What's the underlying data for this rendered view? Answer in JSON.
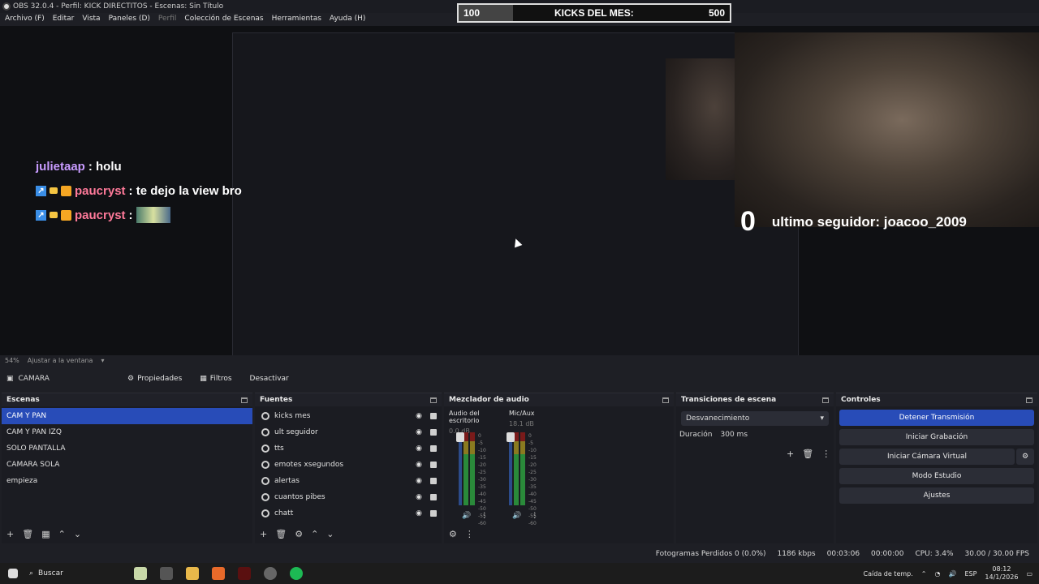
{
  "window": {
    "title": "OBS 32.0.4 - Perfil: KICK DIRECTITOS - Escenas: Sin Título"
  },
  "menu": [
    "Archivo (F)",
    "Editar",
    "Vista",
    "Paneles (D)",
    "Perfil",
    "Colección de Escenas",
    "Herramientas",
    "Ayuda (H)"
  ],
  "overlay": {
    "kicks_left": "100",
    "kicks_label": "KICKS DEL MES:",
    "kicks_right": "500",
    "kicks_progress": 0.2,
    "chat": [
      {
        "user": "julietaap",
        "message": ": holu"
      },
      {
        "user": "paucryst",
        "message": ": te dejo la view bro"
      },
      {
        "user": "paucryst",
        "message": ":"
      }
    ],
    "follower_count": "0",
    "follower_label": "ultimo seguidor: joacoo_2009"
  },
  "zoom": {
    "level": "54%",
    "fit": "Ajustar a la ventana"
  },
  "context": {
    "source": "CAMARA",
    "properties": "Propiedades",
    "filters": "Filtros",
    "deactivate": "Desactivar"
  },
  "scenes": {
    "title": "Escenas",
    "items": [
      "CAM Y PAN",
      "CAM Y PAN IZQ",
      "SOLO PANTALLA",
      "CAMARA SOLA",
      "empieza"
    ],
    "selected": 0
  },
  "sources": {
    "title": "Fuentes",
    "items": [
      "kicks mes",
      "ult seguidor",
      "tts",
      "emotes xsegundos",
      "alertas",
      "cuantos pibes",
      "chatt"
    ]
  },
  "mixer": {
    "title": "Mezclador de audio",
    "channels": [
      {
        "name": "Audio del escritorio",
        "db": "0.0 dB"
      },
      {
        "name": "Mic/Aux",
        "db": "18.1 dB"
      }
    ],
    "ticks": [
      "0",
      "-5",
      "-10",
      "-15",
      "-20",
      "-25",
      "-30",
      "-35",
      "-40",
      "-45",
      "-50",
      "-55",
      "-60"
    ]
  },
  "transitions": {
    "title": "Transiciones de escena",
    "selected": "Desvanecimiento",
    "duration_label": "Duración",
    "duration": "300 ms"
  },
  "controls": {
    "title": "Controles",
    "buttons": [
      "Detener Transmisión",
      "Iniciar Grabación",
      "Iniciar Cámara Virtual",
      "Modo Estudio",
      "Ajustes"
    ]
  },
  "status": {
    "dropped": "Fotogramas Perdidos 0 (0.0%)",
    "bitrate": "1186 kbps",
    "stream_time": "00:03:06",
    "rec_time": "00:00:00",
    "cpu": "CPU: 3.4%",
    "fps": "30.00 / 30.00 FPS"
  },
  "taskbar": {
    "search": "Buscar",
    "weather": "Caída de temp.",
    "lang": "ESP",
    "time": "08:12",
    "date": "14/1/2026"
  }
}
